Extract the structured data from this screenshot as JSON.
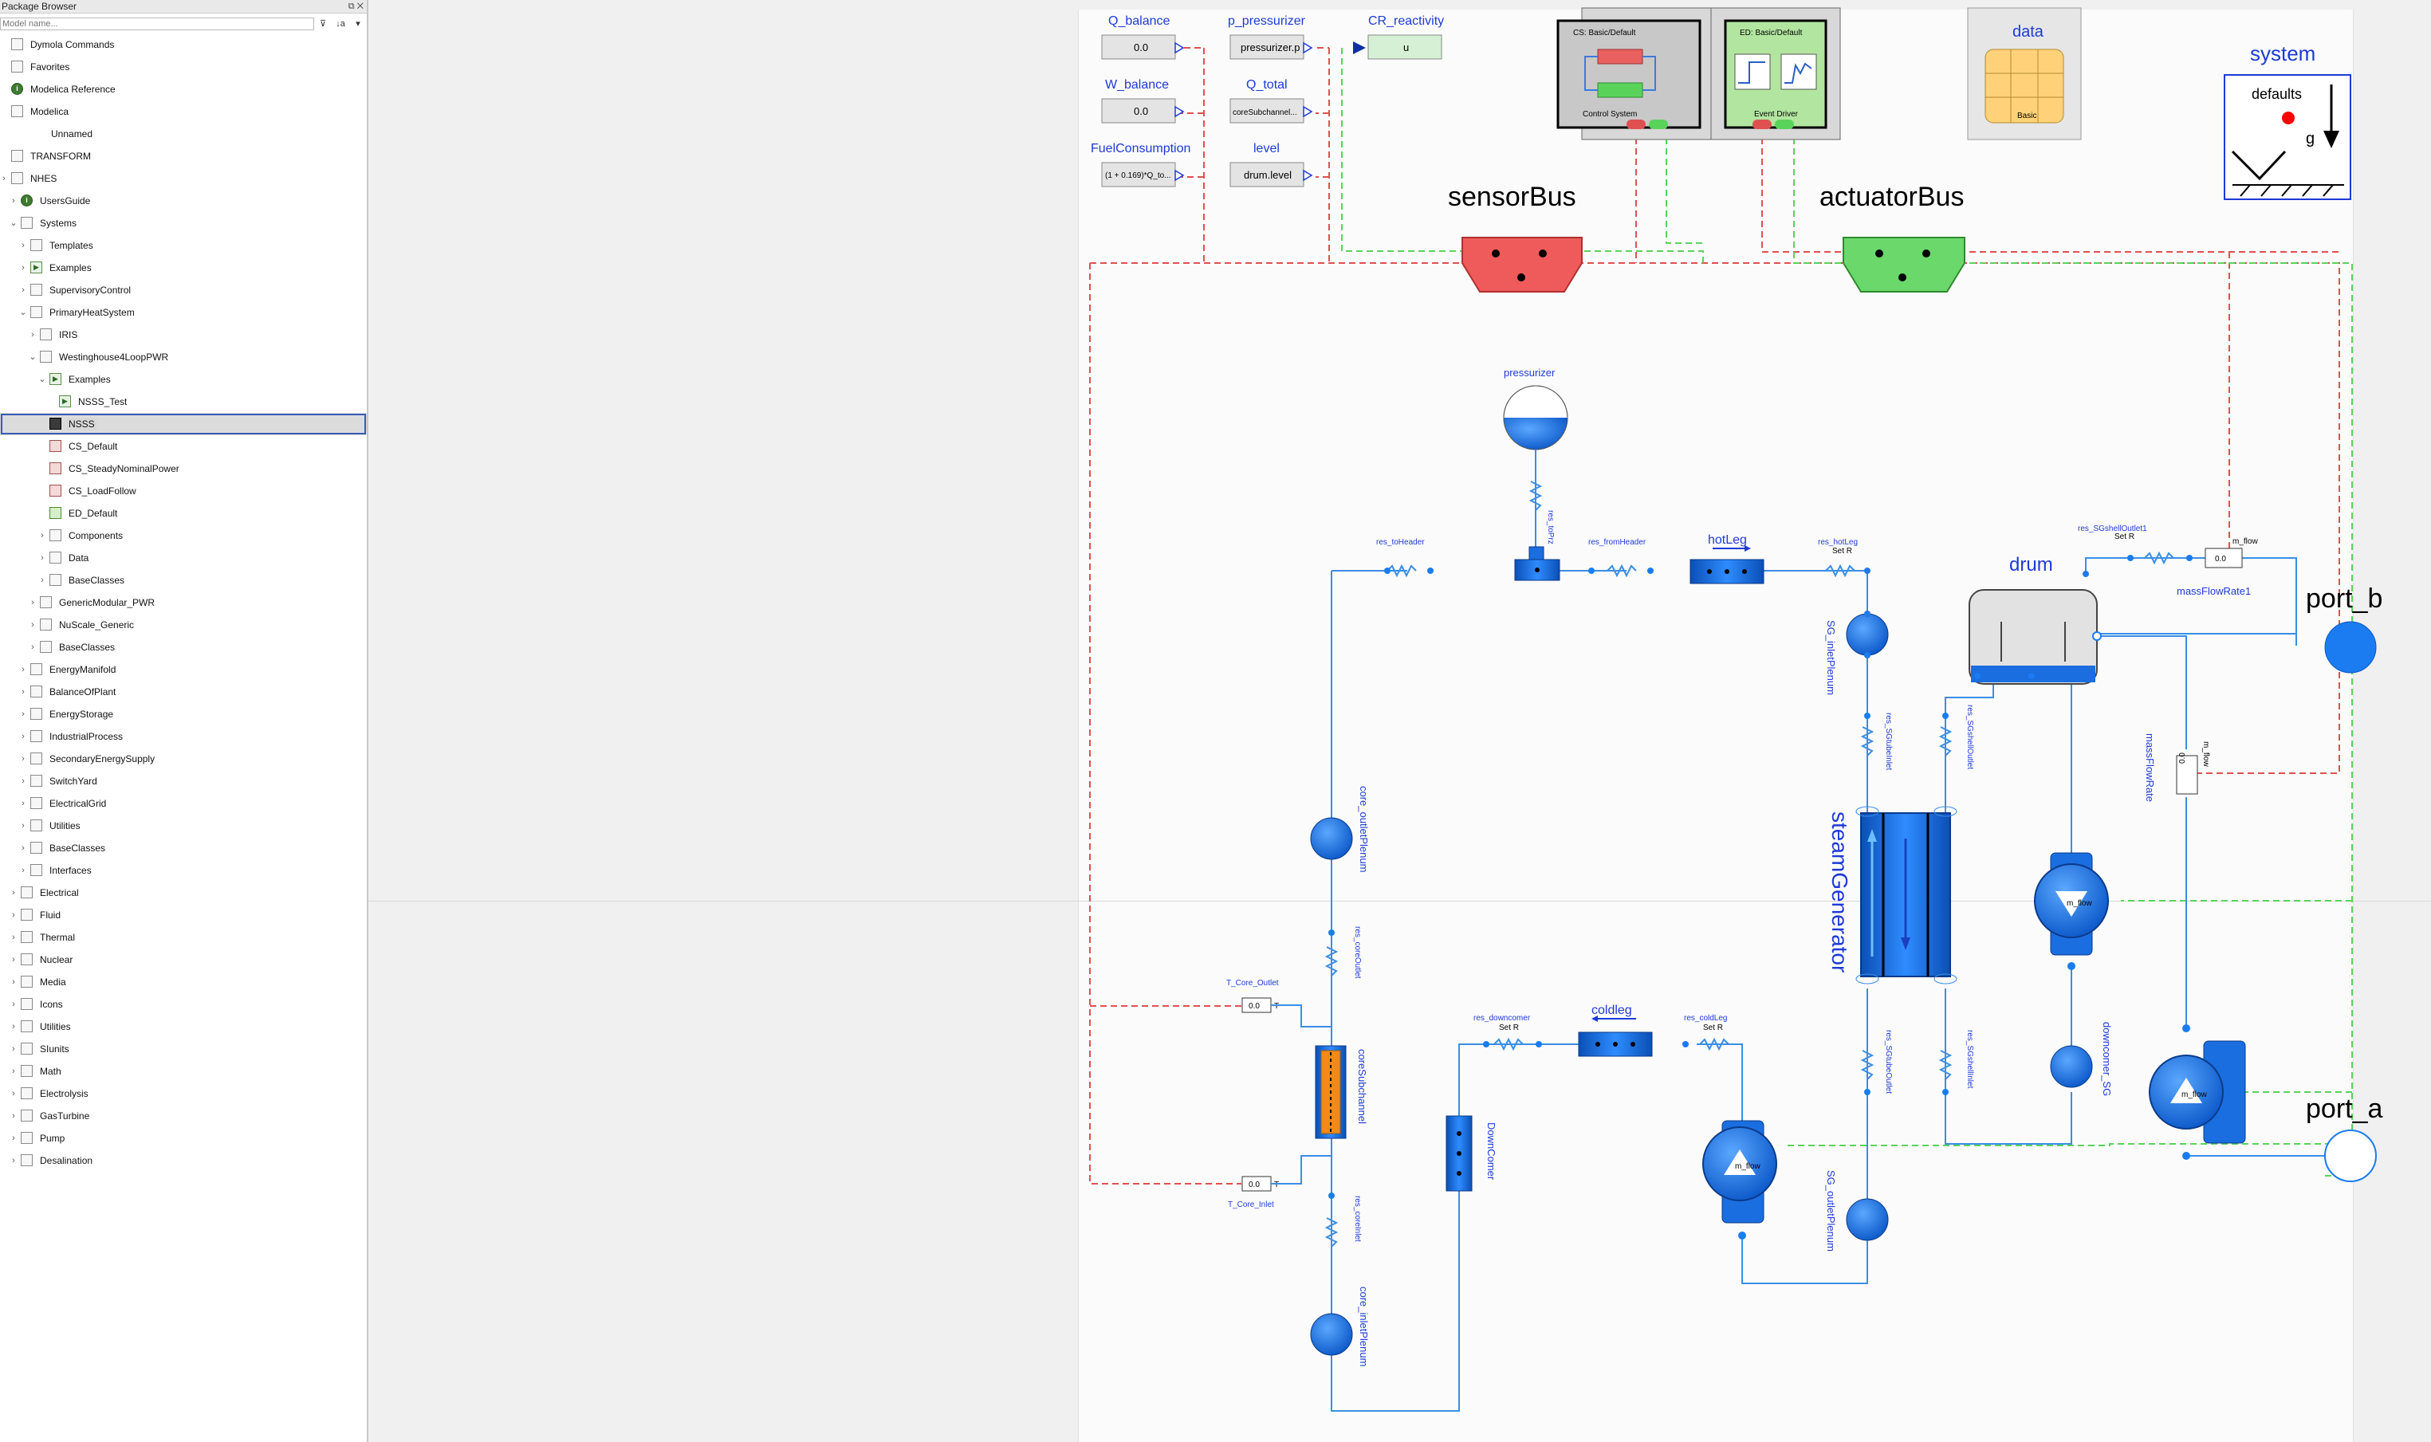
{
  "package_browser": {
    "title": "Package Browser",
    "filter_placeholder": "Model name...",
    "items": [
      {
        "label": "Dymola Commands",
        "icon": "document-icon"
      },
      {
        "label": "Favorites",
        "icon": "folder-icon"
      },
      {
        "label": "Modelica Reference",
        "icon": "info-icon"
      },
      {
        "label": "Modelica",
        "icon": "modelica-icon"
      },
      {
        "label": "Unnamed",
        "icon": ""
      },
      {
        "label": "TRANSFORM",
        "icon": "transform-icon"
      },
      {
        "label": "NHES",
        "icon": "package-icon"
      },
      {
        "label": "UsersGuide",
        "icon": "info-icon"
      },
      {
        "label": "Systems",
        "icon": "systems-icon"
      },
      {
        "label": "Templates",
        "icon": "templates-icon"
      },
      {
        "label": "Examples",
        "icon": "play-icon"
      },
      {
        "label": "SupervisoryControl",
        "icon": "control-icon"
      },
      {
        "label": "PrimaryHeatSystem",
        "icon": "package-icon"
      },
      {
        "label": "IRIS",
        "icon": "package-icon"
      },
      {
        "label": "Westinghouse4LoopPWR",
        "icon": "package-icon"
      },
      {
        "label": "Examples",
        "icon": "play-icon"
      },
      {
        "label": "NSSS_Test",
        "icon": "play-icon"
      },
      {
        "label": "NSSS",
        "icon": "nsss-icon"
      },
      {
        "label": "CS_Default",
        "icon": "cs-icon"
      },
      {
        "label": "CS_SteadyNominalPower",
        "icon": "cs-icon"
      },
      {
        "label": "CS_LoadFollow",
        "icon": "cs-icon"
      },
      {
        "label": "ED_Default",
        "icon": "ed-icon"
      },
      {
        "label": "Components",
        "icon": "package-icon"
      },
      {
        "label": "Data",
        "icon": "package-icon"
      },
      {
        "label": "BaseClasses",
        "icon": "baseclass-icon"
      },
      {
        "label": "GenericModular_PWR",
        "icon": "package-icon"
      },
      {
        "label": "NuScale_Generic",
        "icon": "package-icon"
      },
      {
        "label": "BaseClasses",
        "icon": "baseclass-icon"
      },
      {
        "label": "EnergyManifold",
        "icon": "manifold-icon"
      },
      {
        "label": "BalanceOfPlant",
        "icon": "bop-icon"
      },
      {
        "label": "EnergyStorage",
        "icon": "storage-icon"
      },
      {
        "label": "IndustrialProcess",
        "icon": "industry-icon"
      },
      {
        "label": "SecondaryEnergySupply",
        "icon": "secondary-icon"
      },
      {
        "label": "SwitchYard",
        "icon": "switchyard-icon"
      },
      {
        "label": "ElectricalGrid",
        "icon": "grid-icon"
      },
      {
        "label": "Utilities",
        "icon": "utilities-icon"
      },
      {
        "label": "BaseClasses",
        "icon": "baseclass-icon"
      },
      {
        "label": "Interfaces",
        "icon": "interfaces-icon"
      },
      {
        "label": "Electrical",
        "icon": "electrical-icon"
      },
      {
        "label": "Fluid",
        "icon": "fluid-icon"
      },
      {
        "label": "Thermal",
        "icon": "thermal-icon"
      },
      {
        "label": "Nuclear",
        "icon": "nuclear-icon"
      },
      {
        "label": "Media",
        "icon": "media-icon"
      },
      {
        "label": "Icons",
        "icon": "icons-icon"
      },
      {
        "label": "Utilities",
        "icon": "utilities-icon"
      },
      {
        "label": "SIunits",
        "icon": "siunits-icon"
      },
      {
        "label": "Math",
        "icon": "math-icon"
      },
      {
        "label": "Electrolysis",
        "icon": "package-icon"
      },
      {
        "label": "GasTurbine",
        "icon": "package-icon"
      },
      {
        "label": "Pump",
        "icon": "package-icon"
      },
      {
        "label": "Desalination",
        "icon": "package-icon"
      }
    ]
  },
  "diagram": {
    "outputs": {
      "q_balance": {
        "label": "Q_balance",
        "value": "0.0"
      },
      "w_balance": {
        "label": "W_balance",
        "value": "0.0"
      },
      "fuel": {
        "label": "FuelConsumption",
        "value": "(1 + 0.169)*Q_to..."
      },
      "p_pressurizer": {
        "label": "p_pressurizer",
        "value": "pressurizer.p"
      },
      "q_total": {
        "label": "Q_total",
        "value": "coreSubchannel..."
      },
      "level": {
        "label": "level",
        "value": "drum.level"
      },
      "cr_reactivity": {
        "label": "CR_reactivity",
        "value": "u"
      }
    },
    "control_system": {
      "header": "CS: Basic/Default",
      "footer": "Control System",
      "port_left": "CS",
      "port_right": "ED"
    },
    "event_driver": {
      "header": "ED: Basic/Default",
      "footer": "Event Driver",
      "port_left": "CS",
      "port_right": "ED"
    },
    "data": {
      "label": "data",
      "sub": "Basic"
    },
    "system": {
      "label": "system",
      "defaults": "defaults",
      "g": "g"
    },
    "sensor_bus": "sensorBus",
    "actuator_bus": "actuatorBus",
    "pressurizer": "pressurizer",
    "res_toPrz": "res_toPrz",
    "res_toHeader": "res_toHeader",
    "res_fromHeader": "res_fromHeader",
    "hotLeg": "hotLeg",
    "res_hotLeg": "res_hotLeg",
    "set_r": "Set R",
    "sg_inletPlenum": "SG_inletPlenum",
    "res_SGshellOutlet1": "res_SGshellOutlet1",
    "drum": "drum",
    "massFlowRate1": "massFlowRate1",
    "massFlowRate1_value": "0.0",
    "m_flow": "m_flow",
    "massFlowRate": "massFlowRate",
    "massFlowRate_value": "0.0",
    "port_b": "port_b",
    "port_a": "port_a",
    "res_SGtubeInlet": "res_SGtubeInlet",
    "res_SGshellOutlet": "res_SGshellOutlet",
    "steamGenerator": "steamGenerator",
    "core_outletPlenum": "core_outletPlenum",
    "res_coreOutlet": "res_coreOutlet",
    "T_Core_Outlet": "T_Core_Outlet",
    "T_Core_Outlet_value": "0.0",
    "T_unit": "T",
    "coreSubchannel": "coreSubchannel",
    "T_Core_Inlet": "T_Core_Inlet",
    "T_Core_Inlet_value": "0.0",
    "res_coreInlet": "res_coreInlet",
    "core_inletPlenum": "core_inletPlenum",
    "res_downcomer": "res_downcomer",
    "coldLeg": "coldleg",
    "res_coldLeg": "res_coldLeg",
    "downComer": "DownComer",
    "res_SGtubeOutlet": "res_SGtubeOutlet",
    "res_SGshellInlet": "res_SGshellInlet",
    "sg_outletPlenum": "SG_outletPlenum",
    "downcomer_SG": "downcomer_SG",
    "pump_label": "m_flow"
  },
  "colors": {
    "connector_blue": "#1a7cf0",
    "line_blue": "#3a8ee6",
    "sensor_red": "#e05050",
    "actuator_green": "#5ad35a",
    "label_blue": "#1e3ad6"
  }
}
